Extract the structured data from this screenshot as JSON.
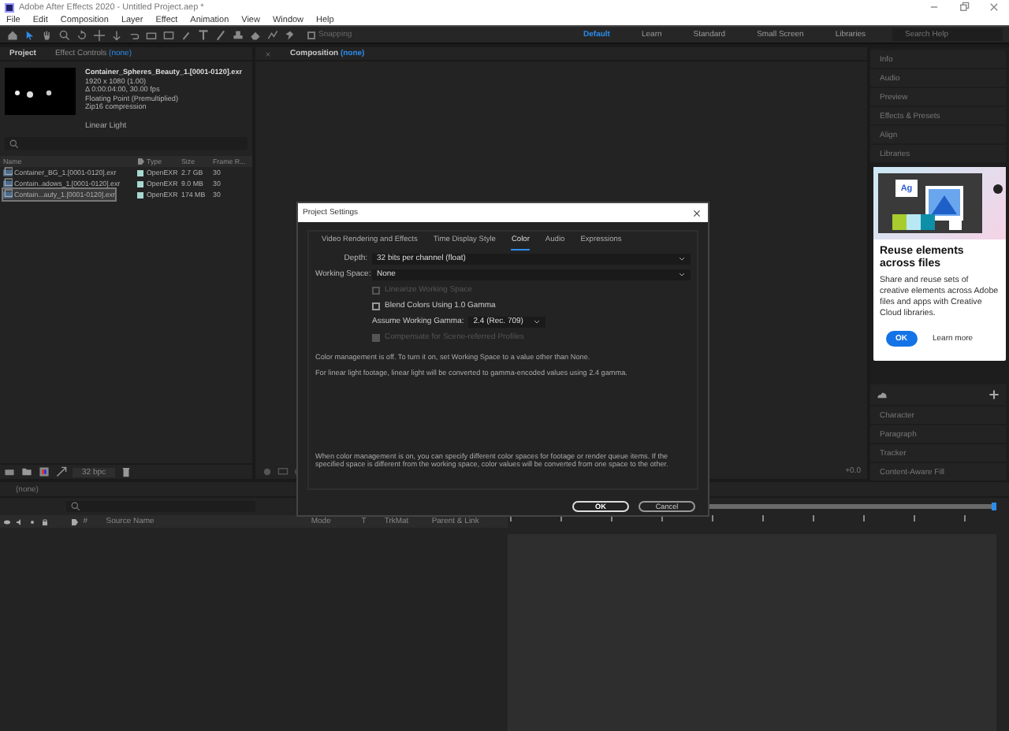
{
  "window": {
    "title": "Adobe After Effects 2020 - Untitled Project.aep *"
  },
  "menu": [
    "File",
    "Edit",
    "Composition",
    "Layer",
    "Effect",
    "Animation",
    "View",
    "Window",
    "Help"
  ],
  "toolbar": {
    "snapping": {
      "label": "Snapping",
      "checked": false
    },
    "workspaces": [
      {
        "label": "Default",
        "selected": true
      },
      {
        "label": "Learn",
        "selected": false
      },
      {
        "label": "Standard",
        "selected": false
      },
      {
        "label": "Small Screen",
        "selected": false
      },
      {
        "label": "Libraries",
        "selected": false
      }
    ],
    "search": {
      "placeholder": "Search Help"
    }
  },
  "project_panel": {
    "tabs": [
      {
        "label": "Project",
        "selected": true
      },
      {
        "label": "Effect Controls",
        "suffix": "(none)",
        "selected": false
      }
    ],
    "preview": {
      "kind": "picture"
    },
    "info": [
      "Container_Spheres_Beauty_1.[0001-0120].exr",
      "1920 x 1080 (1.00)",
      "Δ 0:00:04:00, 30.00 fps",
      "Floating Point (Premultiplied)",
      "Zip16 compression"
    ],
    "color_info": "Linear Light",
    "columns": [
      "Name",
      "Type",
      "Size",
      "Frame R..."
    ],
    "rows": [
      {
        "name": "Container_BG_1.[0001-0120].exr",
        "type": "OpenEXR",
        "size": "2.7 GB",
        "rate": "30",
        "selected": false
      },
      {
        "name": "Contain..adows_1.[0001-0120].exr",
        "type": "OpenEXR",
        "size": "9.0 MB",
        "rate": "30",
        "selected": false
      },
      {
        "name": "Contain...auty_1.[0001-0120].exr",
        "type": "OpenEXR",
        "size": "174 MB",
        "rate": "30",
        "selected": true
      }
    ],
    "bpc": "32 bpc"
  },
  "composition_panel": {
    "tab": "Composition",
    "tab_suffix": "(none)",
    "exposure": "+0.0"
  },
  "right_panels": {
    "top": [
      "Info",
      "Audio",
      "Preview",
      "Effects & Presets",
      "Align"
    ],
    "libraries": "Libraries",
    "card": {
      "ag": "Ag",
      "heading": "Reuse elements across files",
      "body": "Share and reuse sets of creative elements across Adobe files and apps with Creative Cloud libraries.",
      "ok": "OK",
      "link": "Learn more"
    },
    "bottom": [
      "Character",
      "Paragraph",
      "Tracker",
      "Content-Aware Fill"
    ]
  },
  "timeline": {
    "tab": "(none)",
    "zoom_slider": {
      "level": 1
    },
    "columns": [
      "#",
      "Source Name",
      "Mode",
      "T",
      "TrkMat",
      "Parent & Link"
    ]
  },
  "dialog": {
    "title": "Project Settings",
    "tabs": [
      {
        "label": "Video Rendering and Effects",
        "selected": false
      },
      {
        "label": "Time Display Style",
        "selected": false
      },
      {
        "label": "Color",
        "selected": true
      },
      {
        "label": "Audio",
        "selected": false
      },
      {
        "label": "Expressions",
        "selected": false
      }
    ],
    "fields": [
      {
        "kind": "select",
        "label": "Depth:",
        "value": "32 bits per channel (float)"
      },
      {
        "kind": "select",
        "label": "Working Space:",
        "value": "None"
      },
      {
        "kind": "checkbox",
        "label": "Linearize Working Space",
        "checked": false,
        "disabled": true
      },
      {
        "kind": "checkbox",
        "label": "Blend Colors Using 1.0 Gamma",
        "checked": false,
        "disabled": false
      },
      {
        "kind": "inline_select",
        "label": "Assume Working Gamma:",
        "value": "2.4 (Rec. 709)"
      },
      {
        "kind": "checkbox",
        "label": "Compensate for Scene-referred Profiles",
        "checked": true,
        "disabled": true
      }
    ],
    "notes": [
      "Color management is off. To turn it on, set Working Space to a value other than None.",
      "For linear light footage, linear light will be converted to gamma-encoded values using 2.4 gamma."
    ],
    "footnote": "When color management is on, you can specify different color spaces for footage or render queue items. If the specified space is different from the working space, color values will be converted from one space to the other.",
    "buttons": [
      "OK",
      "Cancel"
    ]
  }
}
